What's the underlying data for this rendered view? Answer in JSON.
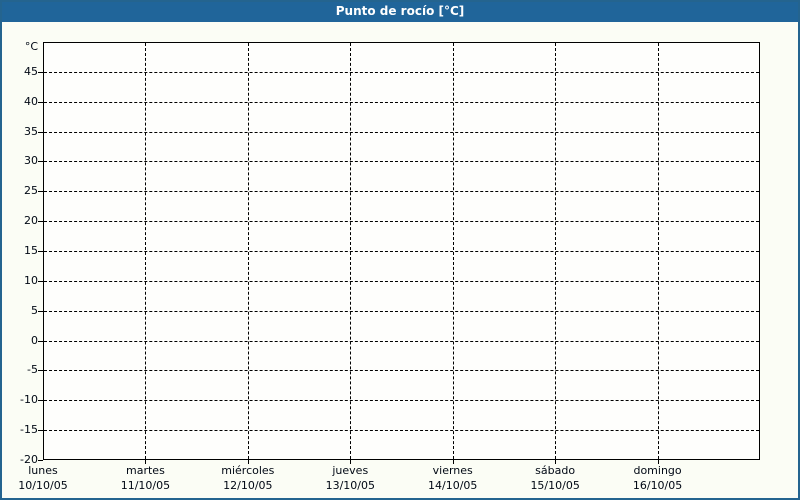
{
  "window": {
    "title": "Punto de rocío [°C]"
  },
  "colors": {
    "titlebar_bg": "#20659a",
    "titlebar_text": "#ffffff",
    "frame_border": "#24648f",
    "page_bg": "#fbfdf5",
    "plot_bg": "#fefefc",
    "axis": "#000000",
    "grid": "#000000",
    "label_text": "#000814"
  },
  "chart_data": {
    "type": "line",
    "title": "Punto de rocío [°C]",
    "y_unit_label": "°C",
    "ylim": [
      -20,
      50
    ],
    "yticks": [
      45,
      40,
      35,
      30,
      25,
      20,
      15,
      10,
      5,
      0,
      -5,
      -10,
      -15,
      -20
    ],
    "grid": true,
    "grid_style": "dashed",
    "categories": [
      "lunes",
      "martes",
      "miércoles",
      "jueves",
      "viernes",
      "sábado",
      "domingo"
    ],
    "x_dates": [
      "10/10/05",
      "11/10/05",
      "12/10/05",
      "13/10/05",
      "14/10/05",
      "15/10/05",
      "16/10/05"
    ],
    "series": []
  }
}
